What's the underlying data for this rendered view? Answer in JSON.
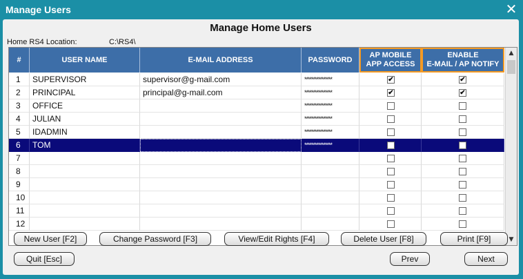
{
  "window": {
    "title": "Manage Users",
    "close_glyph": "✕"
  },
  "heading": "Manage Home Users",
  "location": {
    "label": "Home RS4 Location:",
    "value": "C:\\RS4\\"
  },
  "columns": {
    "num": "#",
    "user": "USER NAME",
    "email": "E-MAIL ADDRESS",
    "password": "PASSWORD",
    "app_access_l1": "AP MOBILE",
    "app_access_l2": "APP ACCESS",
    "notify_l1": "ENABLE",
    "notify_l2": "E-MAIL / AP NOTIFY"
  },
  "rows": [
    {
      "num": "1",
      "user": "SUPERVISOR",
      "email": "supervisor@g-mail.com",
      "password": "****************",
      "app": true,
      "notify": true
    },
    {
      "num": "2",
      "user": "PRINCIPAL",
      "email": "principal@g-mail.com",
      "password": "****************",
      "app": true,
      "notify": true
    },
    {
      "num": "3",
      "user": "OFFICE",
      "email": "",
      "password": "****************",
      "app": false,
      "notify": false
    },
    {
      "num": "4",
      "user": "JULIAN",
      "email": "",
      "password": "****************",
      "app": false,
      "notify": false
    },
    {
      "num": "5",
      "user": "IDADMIN",
      "email": "",
      "password": "****************",
      "app": false,
      "notify": false
    },
    {
      "num": "6",
      "user": "TOM",
      "email": "",
      "password": "****************",
      "app": false,
      "notify": false
    },
    {
      "num": "7",
      "user": "",
      "email": "",
      "password": "",
      "app": false,
      "notify": false
    },
    {
      "num": "8",
      "user": "",
      "email": "",
      "password": "",
      "app": false,
      "notify": false
    },
    {
      "num": "9",
      "user": "",
      "email": "",
      "password": "",
      "app": false,
      "notify": false
    },
    {
      "num": "10",
      "user": "",
      "email": "",
      "password": "",
      "app": false,
      "notify": false
    },
    {
      "num": "11",
      "user": "",
      "email": "",
      "password": "",
      "app": false,
      "notify": false
    },
    {
      "num": "12",
      "user": "",
      "email": "",
      "password": "",
      "app": false,
      "notify": false
    }
  ],
  "selected_row": "6",
  "check_glyph": "✔",
  "scroll": {
    "up_glyph": "▲",
    "down_glyph": "▼"
  },
  "buttons": {
    "new_user": "New User [F2]",
    "change_password": "Change Password [F3]",
    "view_edit_rights": "View/Edit Rights [F4]",
    "delete_user": "Delete User [F8]",
    "print": "Print [F9]",
    "quit": "Quit [Esc]",
    "prev": "Prev",
    "next": "Next"
  },
  "colors": {
    "frame": "#1b8fa6",
    "header": "#3d6ea8",
    "selection": "#0a0a7a",
    "highlight": "#f59a23"
  }
}
